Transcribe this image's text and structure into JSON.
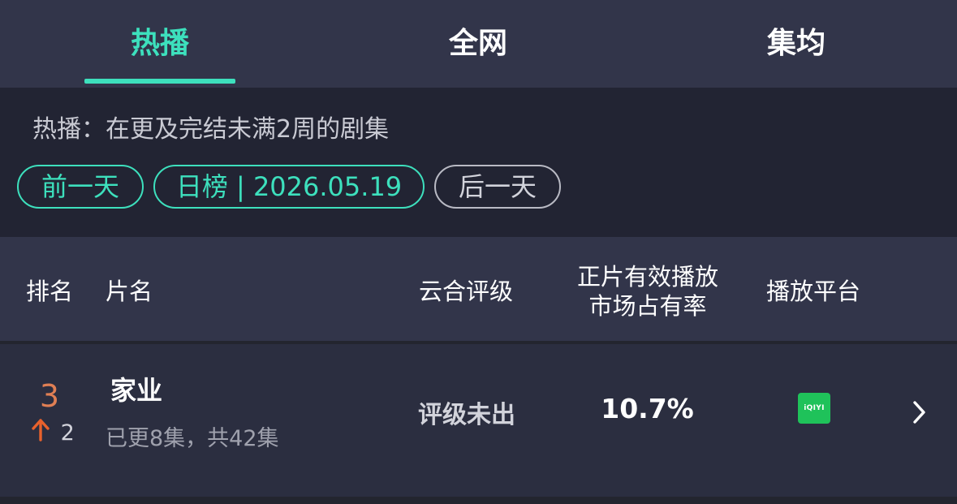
{
  "tabs": [
    {
      "label": "热播",
      "active": true
    },
    {
      "label": "全网",
      "active": false
    },
    {
      "label": "集均",
      "active": false
    }
  ],
  "description": "热播：在更及完结未满2周的剧集",
  "filters": {
    "prev_day": "前一天",
    "current": "日榜 | 2026.05.19",
    "next_day": "后一天"
  },
  "table": {
    "headers": {
      "rank": "排名",
      "name": "片名",
      "rating": "云合评级",
      "share_line1": "正片有效播放",
      "share_line2": "市场占有率",
      "platform": "播放平台"
    },
    "rows": [
      {
        "rank": "3",
        "change_value": "2",
        "change_direction": "up",
        "title": "家业",
        "episodes": "已更8集，共42集",
        "rating": "评级未出",
        "share": "10.7%",
        "platform": "iQIYI"
      }
    ]
  },
  "colors": {
    "accent": "#3de0bd",
    "rank": "#e07f54",
    "up_arrow": "#e8612c",
    "platform_badge": "#1fc25a"
  },
  "icons": {
    "change_arrow": "arrow-up-icon",
    "platform": "iqiyi-logo-icon",
    "row_action": "chevron-right-icon"
  }
}
